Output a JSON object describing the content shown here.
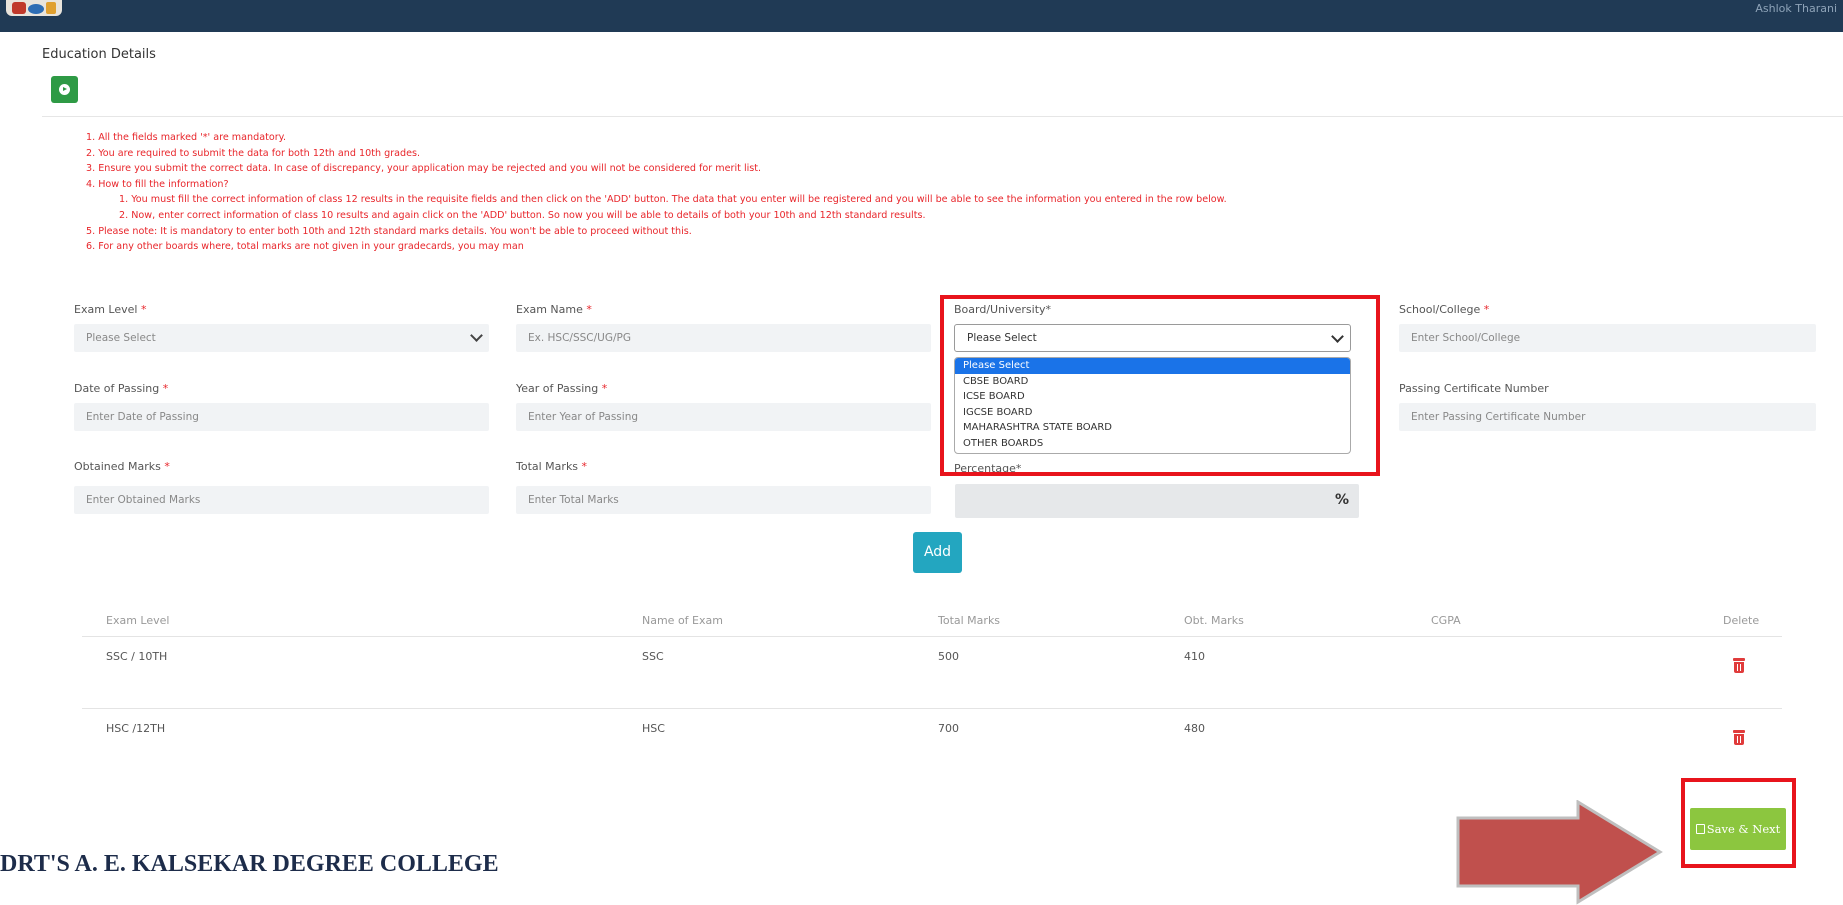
{
  "header": {
    "right_text": "Ashlok Tharani"
  },
  "section_title": "Education Details",
  "instructions": [
    "1. All the fields marked '*' are mandatory.",
    "2. You are required to submit the data for both 12th and 10th grades.",
    "3. Ensure you submit the correct data. In case of discrepancy, your application may be rejected and you will not be considered for merit list.",
    "4. How to fill the information?",
    "1. You must fill the correct information of class 12 results in the requisite fields and then click on the 'ADD' button. The data that you enter will be registered and you will be able to see the information you entered in the row below.",
    "2. Now, enter correct information of class 10 results and again click on the 'ADD' button. So now you will be able to details of both your 10th and 12th standard results.",
    "5. Please note: It is mandatory to enter both 10th and 12th standard marks details. You won't be able to proceed without this.",
    "6. For any other boards where, total marks are not given in your gradecards, you may man"
  ],
  "form": {
    "exam_level": {
      "label": "Exam Level",
      "value": "Please Select"
    },
    "exam_name": {
      "label": "Exam Name",
      "placeholder": "Ex. HSC/SSC/UG/PG"
    },
    "board": {
      "label": "Board/University*",
      "value": "Please Select"
    },
    "school": {
      "label": "School/College",
      "placeholder": "Enter School/College"
    },
    "date_passing": {
      "label": "Date of Passing",
      "placeholder": "Enter Date of Passing"
    },
    "year_passing": {
      "label": "Year of Passing",
      "placeholder": "Enter Year of Passing"
    },
    "cert_number": {
      "label": "Passing Certificate Number",
      "placeholder": "Enter Passing Certificate Number"
    },
    "obtained": {
      "label": "Obtained Marks",
      "placeholder": "Enter Obtained Marks"
    },
    "total": {
      "label": "Total Marks",
      "placeholder": "Enter Total Marks"
    },
    "percentage": {
      "label": "Percentage*",
      "unit": "%"
    },
    "required_mark": "*"
  },
  "board_options": [
    "Please Select",
    "CBSE BOARD",
    "ICSE BOARD",
    "IGCSE BOARD",
    "MAHARASHTRA STATE BOARD",
    "OTHER BOARDS"
  ],
  "add_label": "Add",
  "table": {
    "headers": [
      "Exam Level",
      "Name of Exam",
      "Total Marks",
      "Obt. Marks",
      "CGPA",
      "Delete"
    ],
    "rows": [
      {
        "level": "SSC / 10TH",
        "name": "SSC",
        "total": "500",
        "obtained": "410",
        "cgpa": ""
      },
      {
        "level": "HSC /12TH",
        "name": "HSC",
        "total": "700",
        "obtained": "480",
        "cgpa": ""
      }
    ]
  },
  "save_label": "Save & Next",
  "college_name": "DRT'S A. E. KALSEKAR DEGREE COLLEGE"
}
